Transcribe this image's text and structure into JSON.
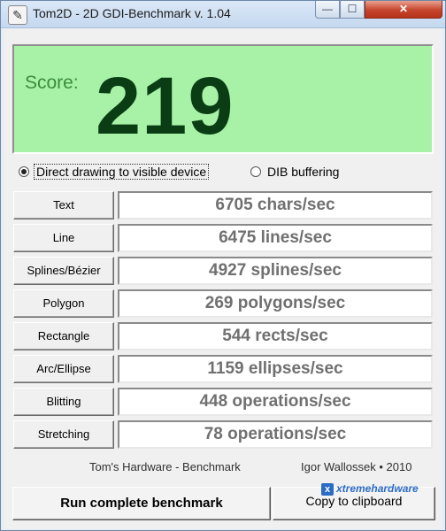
{
  "window": {
    "title": "Tom2D - 2D GDI-Benchmark v. 1.04",
    "icon": "app-icon",
    "controls": {
      "minimize": "—",
      "maximize": "☐",
      "close": "✕"
    }
  },
  "score": {
    "label": "Score:",
    "value": "219",
    "panel_color": "#a8f2a8",
    "value_color": "#0a3d14"
  },
  "modes": {
    "options": [
      {
        "label": "Direct drawing to visible device",
        "checked": true
      },
      {
        "label": "DIB buffering",
        "checked": false
      }
    ]
  },
  "benchmarks": [
    {
      "name": "Text",
      "result": "6705 chars/sec"
    },
    {
      "name": "Line",
      "result": "6475 lines/sec"
    },
    {
      "name": "Splines/Bézier",
      "result": "4927 splines/sec"
    },
    {
      "name": "Polygon",
      "result": "269 polygons/sec"
    },
    {
      "name": "Rectangle",
      "result": "544 rects/sec"
    },
    {
      "name": "Arc/Ellipse",
      "result": "1159 ellipses/sec"
    },
    {
      "name": "Blitting",
      "result": "448 operations/sec"
    },
    {
      "name": "Stretching",
      "result": "78 operations/sec"
    }
  ],
  "footer": {
    "left": "Tom's Hardware - Benchmark",
    "right": "Igor Wallossek • 2010"
  },
  "actions": {
    "run": "Run complete benchmark",
    "copy": "Copy to clipboard"
  },
  "watermark": {
    "text": "xtremehardware",
    "icon": "x"
  }
}
